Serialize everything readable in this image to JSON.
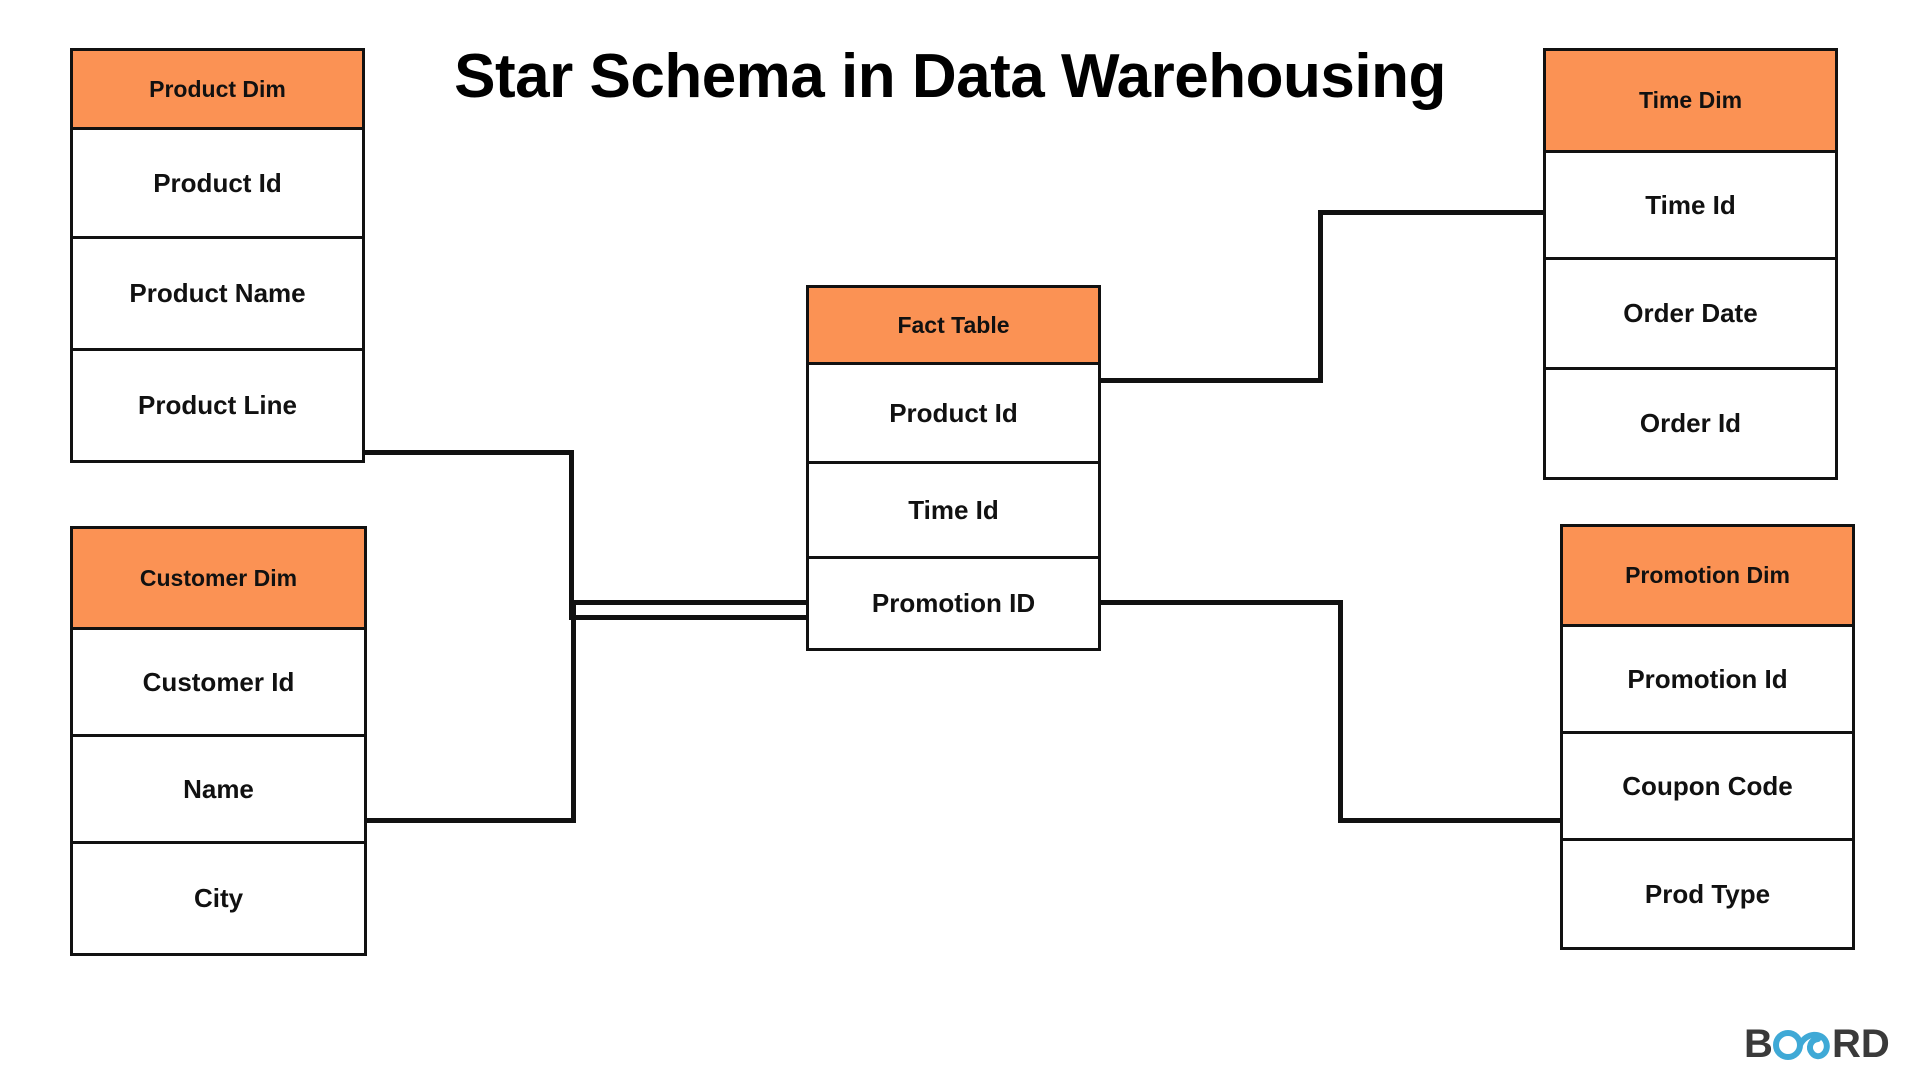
{
  "title": "Star Schema in Data Warehousing",
  "colors": {
    "header_fill": "#FB9254",
    "border": "#111111",
    "text": "#111111",
    "logo_dark": "#3A3A3A",
    "logo_accent": "#3FA9D6",
    "background": "#FFFFFF"
  },
  "entities": {
    "product_dim": {
      "header": "Product Dim",
      "fields": [
        "Product Id",
        "Product Name",
        "Product Line"
      ]
    },
    "time_dim": {
      "header": "Time Dim",
      "fields": [
        "Time Id",
        "Order Date",
        "Order Id"
      ]
    },
    "customer_dim": {
      "header": "Customer Dim",
      "fields": [
        "Customer Id",
        "Name",
        "City"
      ]
    },
    "promotion_dim": {
      "header": "Promotion Dim",
      "fields": [
        "Promotion Id",
        "Coupon Code",
        "Prod Type"
      ]
    },
    "fact_table": {
      "header": "Fact Table",
      "fields": [
        "Product Id",
        "Time Id",
        "Promotion ID"
      ]
    }
  },
  "relationships": [
    {
      "from": "Product Dim",
      "to": "Fact Table"
    },
    {
      "from": "Time Dim",
      "to": "Fact Table"
    },
    {
      "from": "Customer Dim",
      "to": "Fact Table"
    },
    {
      "from": "Promotion Dim",
      "to": "Fact Table"
    }
  ],
  "logo": {
    "text_left": "B",
    "text_accent": "OA",
    "text_right": "RD",
    "full": "BOARD"
  }
}
